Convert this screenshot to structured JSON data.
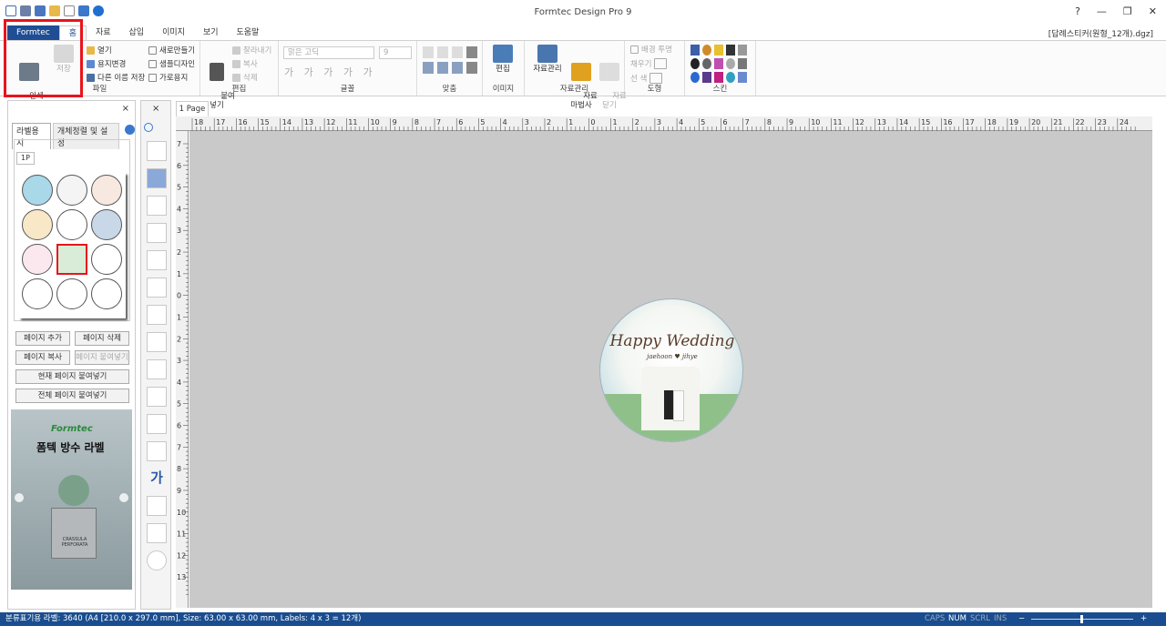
{
  "app": {
    "title": "Formtec Design Pro 9",
    "document": "[답례스티커(원형_12개).dgz]"
  },
  "menu_tabs": [
    "Formtec",
    "홈",
    "자료",
    "삽입",
    "이미지",
    "보기",
    "도움말"
  ],
  "ribbon": {
    "file": {
      "label": "파일",
      "print_preview": "인쇄\n미리보기",
      "save": "저장",
      "open": "열기",
      "change_paper": "용지변경",
      "save_as": "다른 이름 저장",
      "new": "새로만들기",
      "sample_design": "샘플디자인",
      "landscape": "가로용지"
    },
    "edit": {
      "label": "편집",
      "paste": "붙여\n넣기",
      "cut": "잘라내기",
      "copy": "복사",
      "delete": "삭제"
    },
    "font": {
      "label": "글꼴",
      "font_name": "맑은 고딕",
      "font_size": "9"
    },
    "align": {
      "label": "맞춤"
    },
    "image": {
      "label": "이미지",
      "edit": "편집"
    },
    "data": {
      "label": "자료관리",
      "manage": "자료관리",
      "wizard": "자료\n마법사",
      "close": "자료\n닫기"
    },
    "shape": {
      "label": "도형",
      "transparent": "배경 투명",
      "fill": "채우기",
      "line": "선  색"
    },
    "skin": {
      "label": "스킨"
    }
  },
  "left_panel": {
    "tabs": [
      "라벨용지",
      "개체정렬 및 설정"
    ],
    "page_tab": "1P",
    "buttons": {
      "add_page": "페이지 추가",
      "delete_page": "페이지 삭제",
      "copy_page": "페이지 복사",
      "paste_page": "페이지 붙여넣기",
      "paste_current": "현재 페이지 붙여넣기",
      "paste_all": "전체 페이지 붙여넣기"
    },
    "ad": {
      "brand": "Formtec",
      "headline": "폼텍 방수 라벨",
      "pot_text": "CRASSULA\nPERFORATA"
    }
  },
  "doc_tab": "1 Page",
  "label": {
    "title": "Happy Wedding",
    "names": "jaehoon ♥ jihye"
  },
  "status": {
    "text": "분류표기용 라벨: 3640 (A4 [210.0 x 297.0 mm], Size: 63.00 x 63.00 mm,  Labels: 4 x 3 = 12개)",
    "caps": "CAPS",
    "num": "NUM",
    "scrl": "SCRL",
    "ins": "INS"
  },
  "ruler_h": [
    "18",
    "17",
    "16",
    "15",
    "14",
    "13",
    "12",
    "11",
    "10",
    "9",
    "8",
    "7",
    "6",
    "5",
    "4",
    "3",
    "2",
    "1",
    "0",
    "1",
    "2",
    "3",
    "4",
    "5",
    "6",
    "7",
    "8",
    "9",
    "10",
    "11",
    "12",
    "13",
    "14",
    "15",
    "16",
    "17",
    "18",
    "19",
    "20",
    "21",
    "22",
    "23",
    "24"
  ],
  "ruler_v": [
    "7",
    "6",
    "5",
    "4",
    "3",
    "2",
    "1",
    "0",
    "1",
    "2",
    "3",
    "4",
    "5",
    "6",
    "7",
    "8",
    "9",
    "10",
    "11",
    "12",
    "13"
  ]
}
